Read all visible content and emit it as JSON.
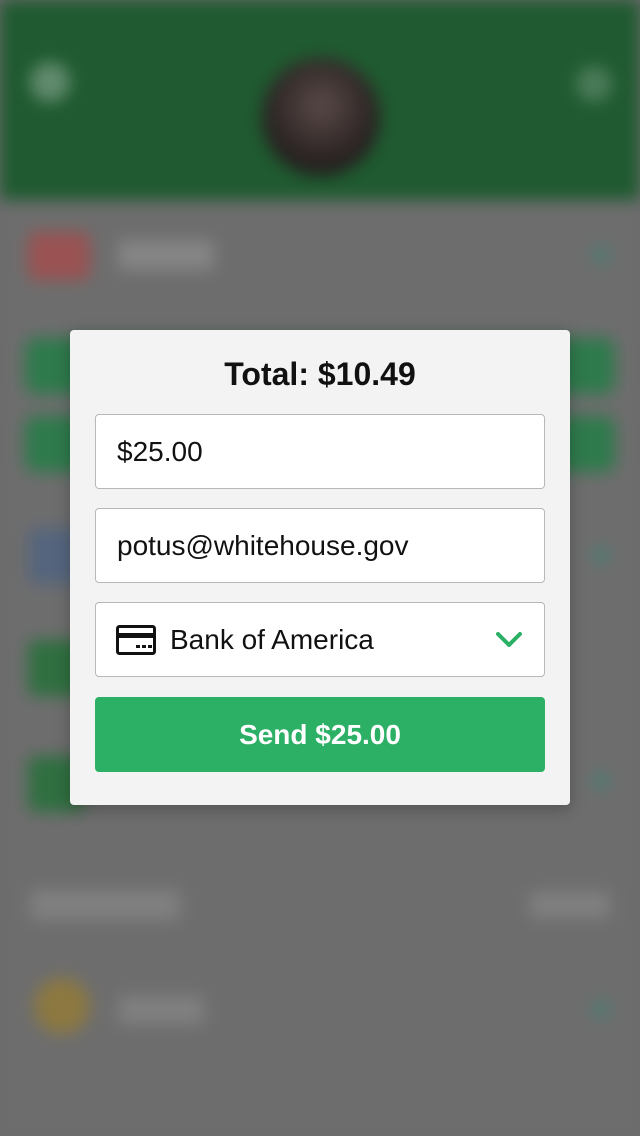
{
  "modal": {
    "title": "Total: $10.49",
    "amount_value": "$25.00",
    "email_value": "potus@whitehouse.gov",
    "payment_method": {
      "label": "Bank of America",
      "icon": "credit-card-icon"
    },
    "dropdown_icon": "chevron-down-icon",
    "send_label": "Send $25.00"
  },
  "colors": {
    "header_green": "#1f5a30",
    "accent_green": "#2bb065",
    "modal_background": "#f3f3f3",
    "overlay": "#6d6d6d"
  }
}
